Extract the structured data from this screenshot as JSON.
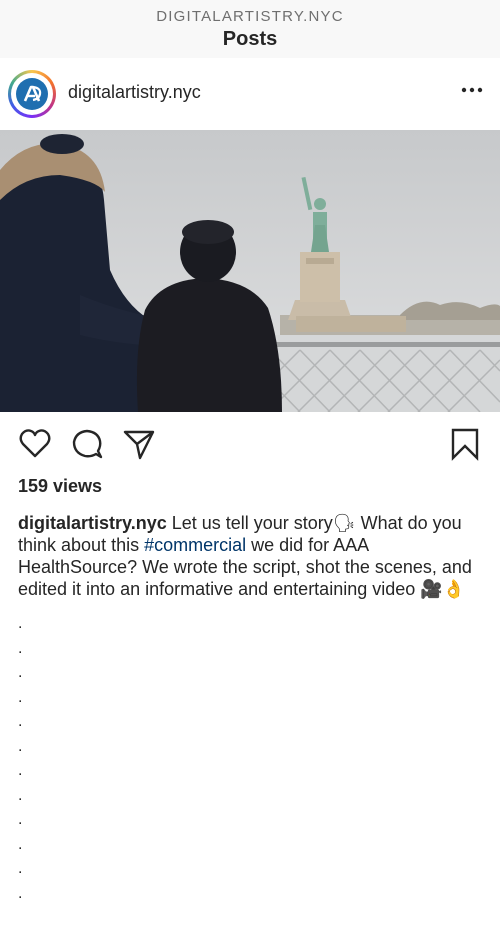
{
  "header": {
    "account_name": "DIGITALARTISTRY.NYC",
    "title": "Posts"
  },
  "post": {
    "username": "digitalartistry.nyc",
    "avatar_icon": "brand-logo-icon",
    "more_icon": "more-options-icon",
    "actions": {
      "like_icon": "heart-icon",
      "comment_icon": "comment-icon",
      "share_icon": "send-icon",
      "save_icon": "bookmark-icon"
    },
    "views": "159 views",
    "caption": {
      "username": "digitalartistry.nyc",
      "text_part1": " Let us tell your story🗣 What do you think about this ",
      "hashtag": "#commercial",
      "text_part2": " we did for AAA HealthSource? We wrote the script, shot the scenes, and edited it into an informative and entertaining video 🎥👌"
    },
    "filler_dots": [
      ".",
      ".",
      ".",
      ".",
      ".",
      ".",
      ".",
      ".",
      ".",
      ".",
      ".",
      "."
    ]
  },
  "colors": {
    "accent_link": "#003569",
    "text": "#262626",
    "topbar_bg": "#f8f8f8"
  }
}
